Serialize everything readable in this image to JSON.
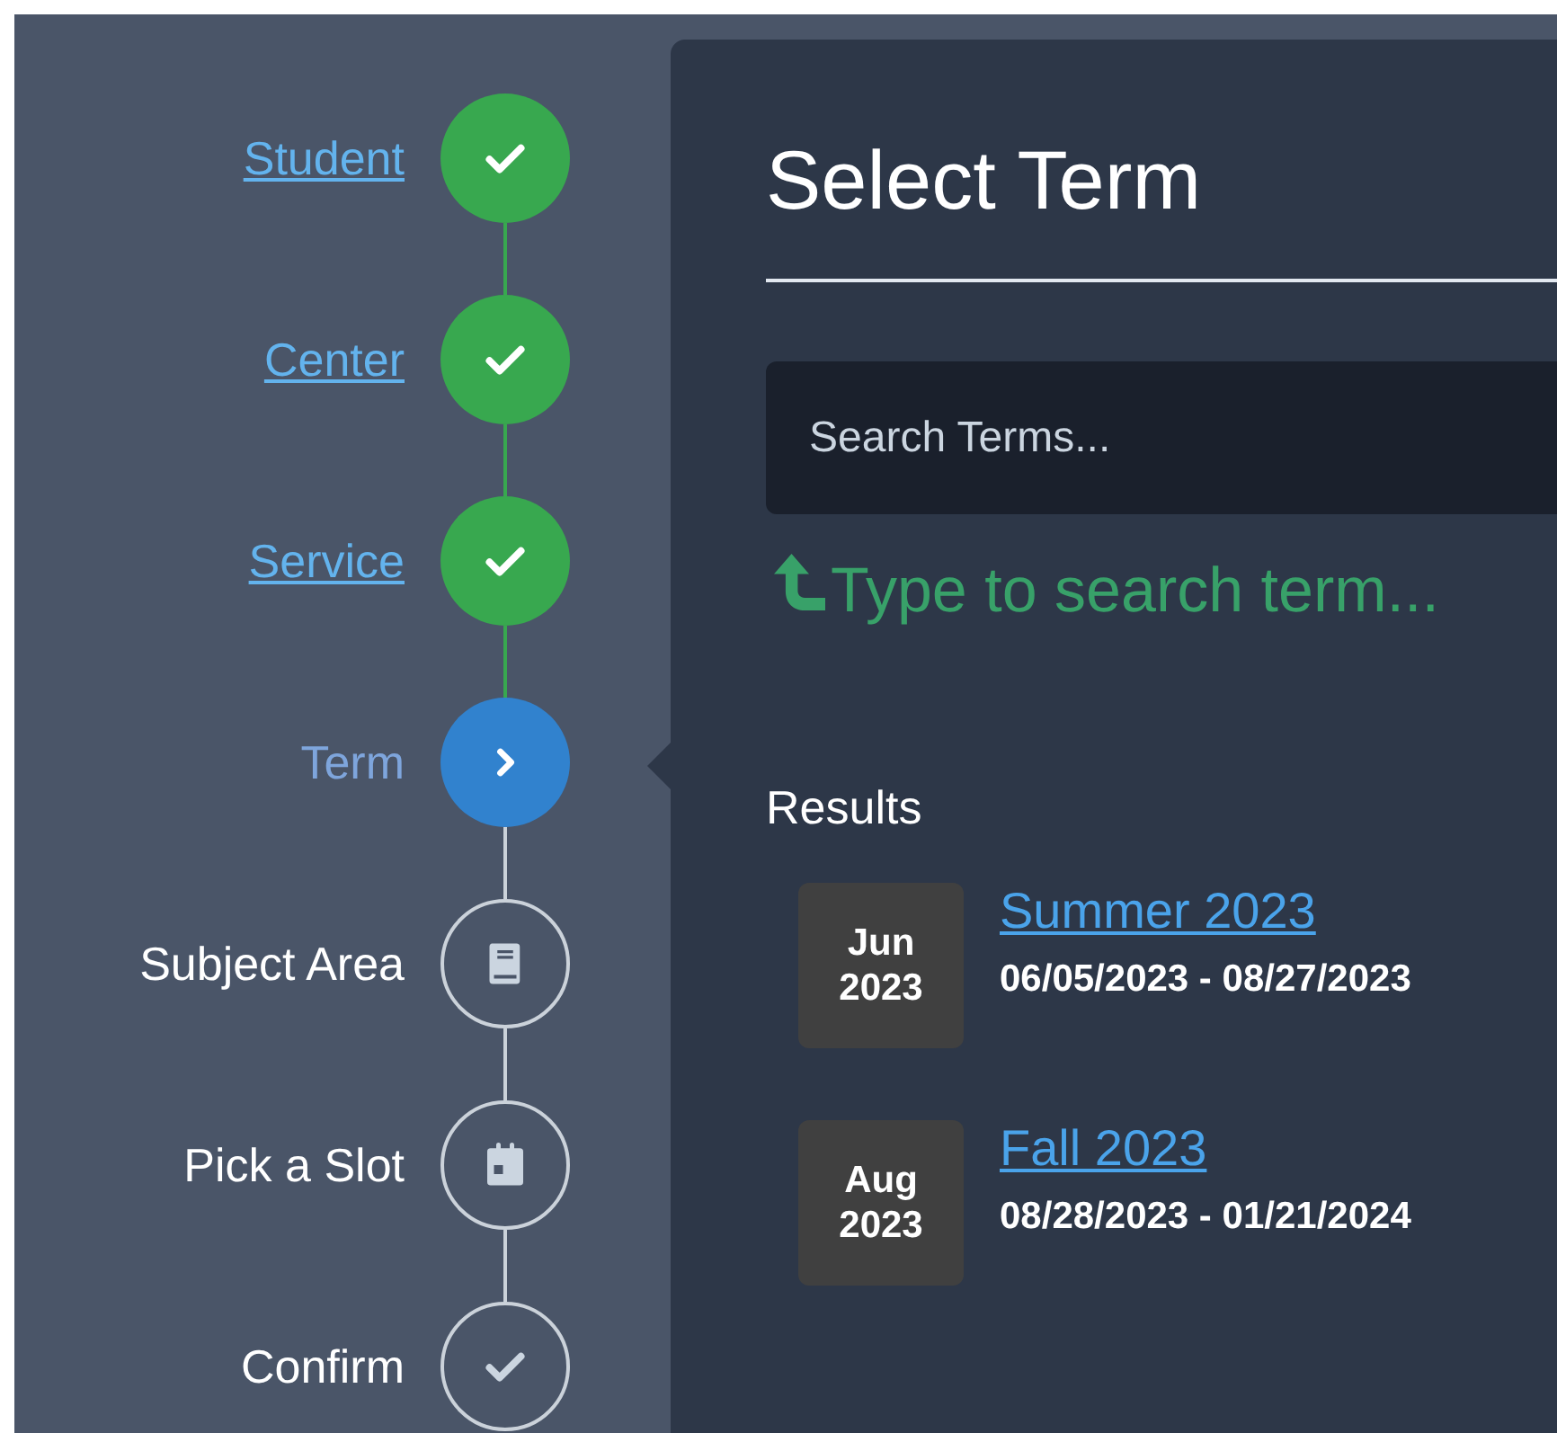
{
  "steps": [
    {
      "label": "Student",
      "completed": true,
      "selected": false
    },
    {
      "label": "Center",
      "completed": true,
      "selected": false
    },
    {
      "label": "Service",
      "completed": true,
      "selected": false
    },
    {
      "label": "Term",
      "completed": false,
      "selected": true
    },
    {
      "label": "Subject Area",
      "completed": false,
      "selected": false
    },
    {
      "label": "Pick a Slot",
      "completed": false,
      "selected": false
    },
    {
      "label": "Confirm",
      "completed": false,
      "selected": false
    }
  ],
  "panel": {
    "title": "Select Term",
    "search": {
      "placeholder": "Search Terms..."
    },
    "hint": "Type to search term...",
    "results_heading": "Results",
    "results": [
      {
        "month": "Jun",
        "year": "2023",
        "name": "Summer 2023",
        "dates": "06/05/2023 - 08/27/2023"
      },
      {
        "month": "Aug",
        "year": "2023",
        "name": "Fall 2023",
        "dates": "08/28/2023 - 01/21/2024"
      }
    ]
  }
}
